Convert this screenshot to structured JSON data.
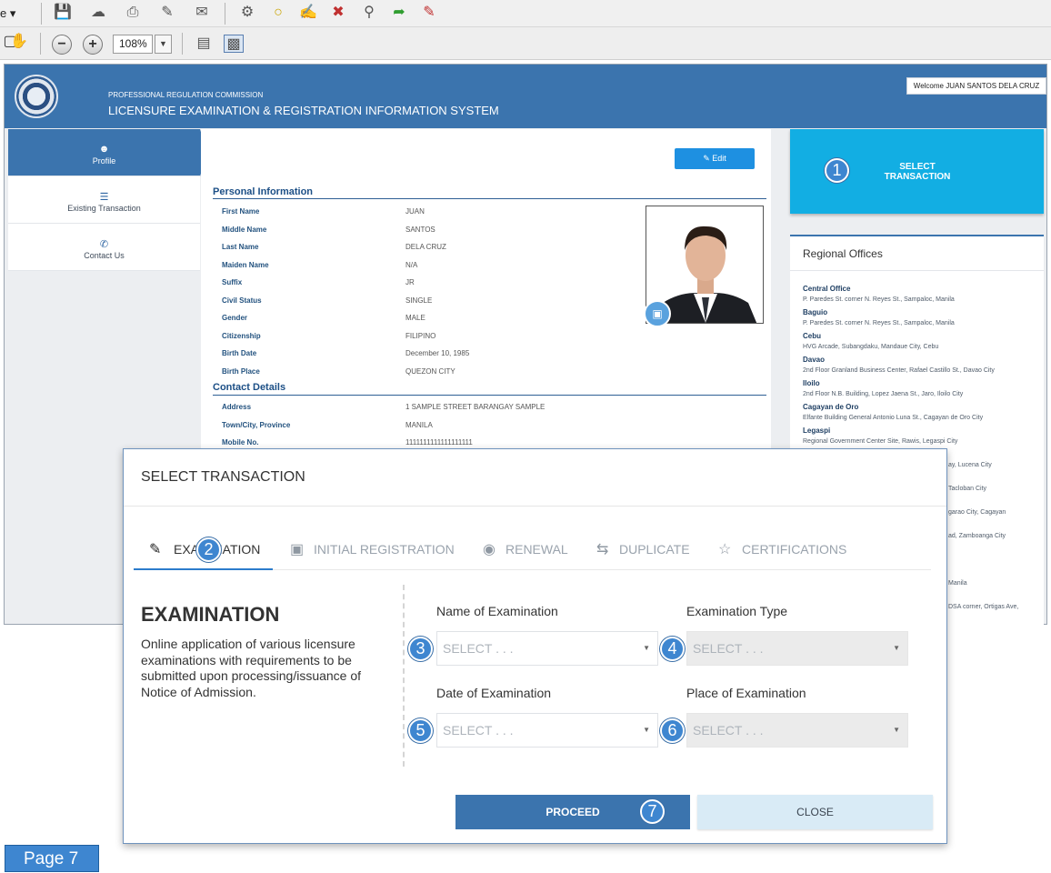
{
  "toolbar": {
    "partial_menu_label": "e ▾",
    "zoom_value": "108%"
  },
  "header": {
    "org": "PROFESSIONAL REGULATION COMMISSION",
    "system": "LICENSURE EXAMINATION & REGISTRATION INFORMATION SYSTEM",
    "welcome": "Welcome JUAN SANTOS DELA CRUZ"
  },
  "sidebar": {
    "items": [
      {
        "label": "Profile"
      },
      {
        "label": "Existing Transaction"
      },
      {
        "label": "Contact Us"
      }
    ]
  },
  "profile": {
    "edit_label": "Edit",
    "personal_title": "Personal Information",
    "personal": [
      {
        "label": "First Name",
        "value": "JUAN"
      },
      {
        "label": "Middle Name",
        "value": "SANTOS"
      },
      {
        "label": "Last Name",
        "value": "DELA CRUZ"
      },
      {
        "label": "Maiden Name",
        "value": "N/A"
      },
      {
        "label": "Suffix",
        "value": "JR"
      },
      {
        "label": "Civil Status",
        "value": "SINGLE"
      },
      {
        "label": "Gender",
        "value": "MALE"
      },
      {
        "label": "Citizenship",
        "value": "FILIPINO"
      },
      {
        "label": "Birth Date",
        "value": "December 10, 1985"
      },
      {
        "label": "Birth Place",
        "value": "QUEZON CITY"
      }
    ],
    "contact_title": "Contact Details",
    "contact": [
      {
        "label": "Address",
        "value": "1 SAMPLE STREET BARANGAY SAMPLE"
      },
      {
        "label": "Town/City, Province",
        "value": "MANILA"
      },
      {
        "label": "Mobile No.",
        "value": "1111111111111111111"
      }
    ]
  },
  "select_transaction_tile": {
    "line1": "SELECT",
    "line2": "TRANSACTION"
  },
  "regional_offices": {
    "title": "Regional Offices",
    "offices": [
      {
        "name": "Central Office",
        "address": "P. Paredes St. corner N. Reyes St., Sampaloc, Manila"
      },
      {
        "name": "Baguio",
        "address": "P. Paredes St. corner N. Reyes St., Sampaloc, Manila"
      },
      {
        "name": "Cebu",
        "address": "HVG Arcade, Subangdaku, Mandaue City, Cebu"
      },
      {
        "name": "Davao",
        "address": "2nd Floor Granland Business Center, Rafael Castillo St., Davao City"
      },
      {
        "name": "Iloilo",
        "address": "2nd Floor N.B. Building, Lopez Jaena St., Jaro, Iloilo City"
      },
      {
        "name": "Cagayan de Oro",
        "address": "Elfante Building General Antonio Luna St., Cagayan de Oro City"
      },
      {
        "name": "Legaspi",
        "address": "Regional Government Center Site, Rawis, Legaspi City"
      }
    ],
    "partial_lines": [
      "ay, Lucena City",
      "Tacloban City",
      "garao City, Cagayan",
      "ad, Zamboanga City",
      "Manila",
      "DSA corner, Ortigas Ave,"
    ]
  },
  "modal": {
    "title": "SELECT TRANSACTION",
    "tabs": [
      {
        "label": "EXAMINATION"
      },
      {
        "label": "INITIAL REGISTRATION"
      },
      {
        "label": "RENEWAL"
      },
      {
        "label": "DUPLICATE"
      },
      {
        "label": "CERTIFICATIONS"
      }
    ],
    "heading": "EXAMINATION",
    "description": "Online application of various licensure examinations with requirements to be submitted upon processing/issuance of Notice of Admission.",
    "fields": {
      "name_label": "Name of Examination",
      "name_placeholder": "SELECT . . .",
      "type_label": "Examination Type",
      "type_placeholder": "SELECT . . .",
      "date_label": "Date of Examination",
      "date_placeholder": "SELECT . . .",
      "place_label": "Place of Examination",
      "place_placeholder": "SELECT . . ."
    },
    "proceed_label": "PROCEED",
    "close_label": "CLOSE"
  },
  "badges": [
    "1",
    "2",
    "3",
    "4",
    "5",
    "6",
    "7"
  ],
  "page_label": "Page 7",
  "colors": {
    "primary": "#3b74ae",
    "tile": "#12aee3",
    "badge": "#3e86d0"
  }
}
